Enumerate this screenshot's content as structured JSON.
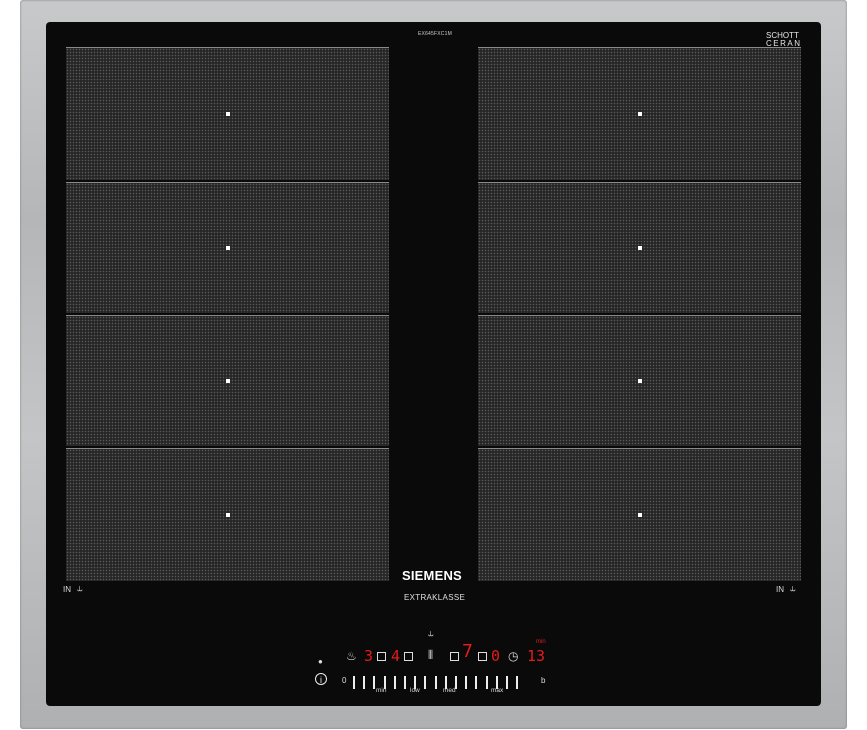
{
  "cooktop": {
    "model_code": "EX645FXC1M",
    "schott_logo": "SCHOTT",
    "ceran_logo": "CERAN",
    "schott_sub": "",
    "brand": "SIEMENS",
    "series": "EXTRAKLASSE",
    "left_in_label": "IN",
    "right_in_label": "IN"
  },
  "controls": {
    "info_symbol": "i",
    "zone1_level": "3",
    "zone2_level": "4",
    "zone3_level": "7",
    "zone4_level": "0",
    "timer_value": "13",
    "timer_unit": "min",
    "scale_start": "0",
    "scale_end": "b",
    "scale_labels": [
      "min",
      "low",
      "med",
      "max"
    ]
  },
  "colors": {
    "display_red": "#e51b1b",
    "glass": "#0a0a0a",
    "frame": "#bdbebf"
  },
  "icons": [
    "flex-icon",
    "pan-icon",
    "timer-icon",
    "power-indicator-icon"
  ]
}
